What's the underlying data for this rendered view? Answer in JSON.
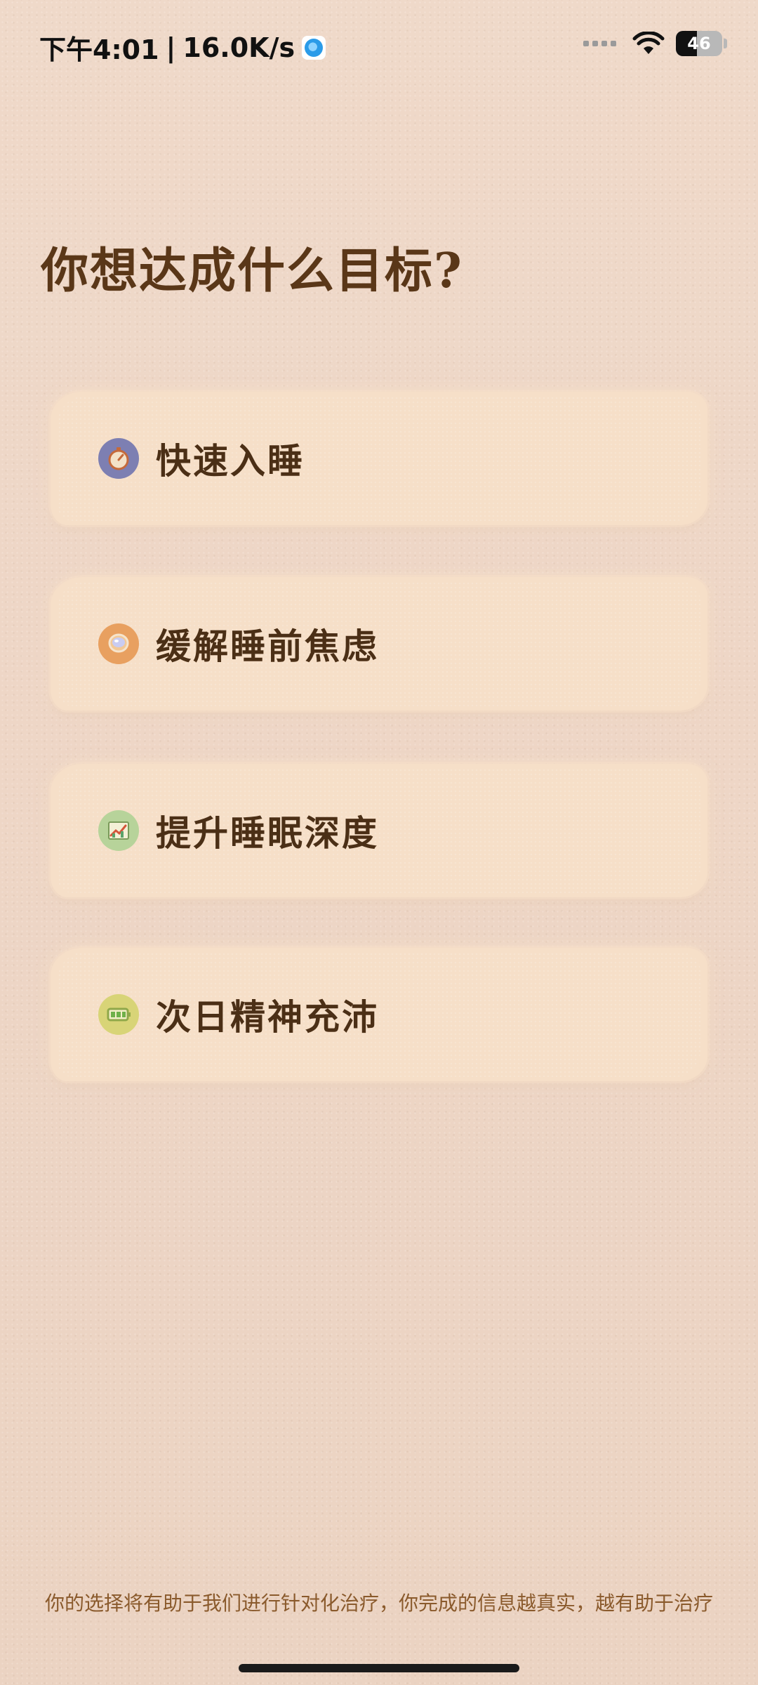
{
  "status_bar": {
    "time": "下午4:01",
    "separator": "|",
    "net_speed": "16.0K/s",
    "battery_level": "46",
    "battery_fraction": 0.46
  },
  "title": "你想达成什么目标?",
  "options": [
    {
      "label": "快速入睡",
      "icon": "stopwatch-icon"
    },
    {
      "label": "缓解睡前焦虑",
      "icon": "mirror-icon"
    },
    {
      "label": "提升睡眠深度",
      "icon": "chart-icon"
    },
    {
      "label": "次日精神充沛",
      "icon": "battery-icon"
    }
  ],
  "footer": "你的选择将有助于我们进行针对化治疗，你完成的信息越真实，越有助于治疗",
  "colors": {
    "background": "#ecd5c4",
    "card": "#f6dfc8",
    "title": "#5a3718",
    "footer_text": "#8a5a2c"
  }
}
